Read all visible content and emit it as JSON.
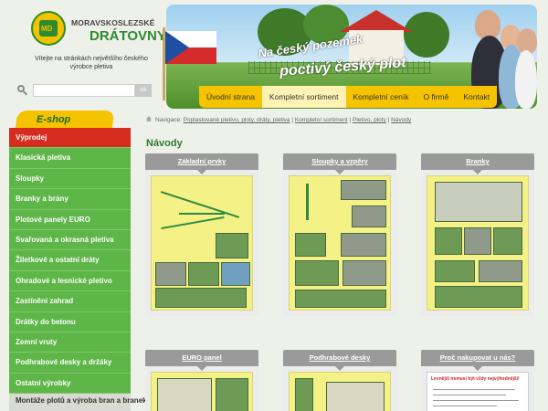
{
  "header": {
    "logo_top": "MORAVSKOSLEZSKÉ",
    "logo_main": "DRÁTOVNY",
    "logo_emblem": "MD",
    "tagline": "Vítejte na stránkách největšího českého výrobce pletiva",
    "search": {
      "placeholder": "",
      "button_label": "ok"
    },
    "banner": {
      "slogan_line1": "Na český pozemek",
      "slogan_line2": "poctivý český plot"
    }
  },
  "nav": {
    "items": [
      {
        "label": "Úvodní strana"
      },
      {
        "label": "Kompletní sortiment"
      },
      {
        "label": "Kompletní ceník"
      },
      {
        "label": "O firmě"
      },
      {
        "label": "Kontakt"
      }
    ]
  },
  "sidebar": {
    "eshop_label": "E-shop",
    "items": [
      {
        "label": "Výprodej"
      },
      {
        "label": "Klasická pletiva"
      },
      {
        "label": "Sloupky"
      },
      {
        "label": "Branky a brány"
      },
      {
        "label": "Plotové panely EURO"
      },
      {
        "label": "Svařovaná a okrasná pletiva"
      },
      {
        "label": "Žiletkové a ostatní dráty"
      },
      {
        "label": "Ohradové a lesnické pletivo"
      },
      {
        "label": "Zastínění zahrad"
      },
      {
        "label": "Drátky do betonu"
      },
      {
        "label": "Zemní vruty"
      },
      {
        "label": "Podhrabové desky a držáky"
      },
      {
        "label": "Ostatní výrobky"
      },
      {
        "label": "Montáže plotů a výroba bran a branek"
      }
    ]
  },
  "breadcrumb": {
    "prefix": "Navigace:",
    "items": [
      {
        "label": "Poplastované pletivo, ploty, dráty, pletiva"
      },
      {
        "label": "Kompletní sortiment"
      },
      {
        "label": "Pletivo, ploty"
      },
      {
        "label": "Návody"
      }
    ]
  },
  "main": {
    "title": "Návody",
    "cards": [
      {
        "title": "Základní prvky"
      },
      {
        "title": "Sloupky a vzpěry"
      },
      {
        "title": "Branky"
      },
      {
        "title": "EURO panel"
      },
      {
        "title": "Podhrabové desky"
      },
      {
        "title": "Proč nakupovat u nás?",
        "doc_title": "Levnější nemusí být vždy nejvýhodnější!"
      }
    ]
  },
  "colors": {
    "brand_green": "#5eb648",
    "accent_yellow": "#f6c300",
    "sale_red": "#d62b1f",
    "title_green": "#2e7a2e"
  },
  "icons": [
    "search-icon",
    "home-icon",
    "logo-emblem"
  ]
}
